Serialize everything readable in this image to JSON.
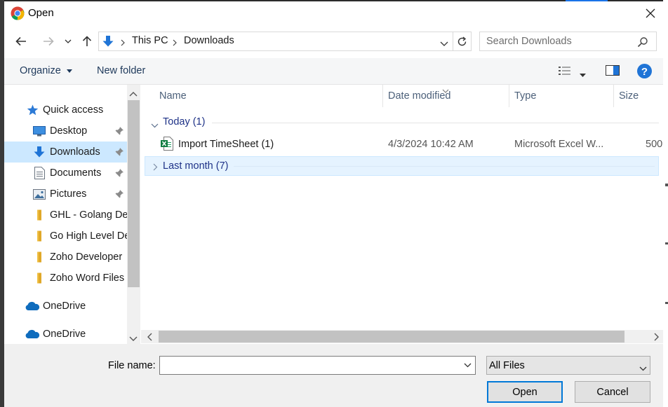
{
  "window": {
    "title": "Open",
    "app_icon": "chrome-icon",
    "accent_color": "#0078d7"
  },
  "address": {
    "crumbs": [
      "This PC",
      "Downloads"
    ],
    "search_placeholder": "Search Downloads"
  },
  "toolbar": {
    "organize_label": "Organize",
    "new_folder_label": "New folder"
  },
  "sidebar": {
    "items": [
      {
        "label": "Quick access",
        "icon": "star-icon"
      },
      {
        "label": "Desktop",
        "icon": "desktop-icon",
        "pinned": true
      },
      {
        "label": "Downloads",
        "icon": "download-icon",
        "pinned": true,
        "selected": true
      },
      {
        "label": "Documents",
        "icon": "document-icon",
        "pinned": true
      },
      {
        "label": "Pictures",
        "icon": "pictures-icon",
        "pinned": true
      },
      {
        "label": "GHL - Golang Dev",
        "icon": "folder-icon"
      },
      {
        "label": "Go High Level Dev",
        "icon": "folder-icon"
      },
      {
        "label": "Zoho Developer",
        "icon": "folder-icon"
      },
      {
        "label": "Zoho Word Files",
        "icon": "folder-icon"
      },
      {
        "label": "OneDrive",
        "icon": "cloud-icon"
      },
      {
        "label": "OneDrive",
        "icon": "cloud-icon"
      }
    ]
  },
  "file_list": {
    "columns": [
      "Name",
      "Date modified",
      "Type",
      "Size"
    ],
    "groups": [
      {
        "label": "Today (1)",
        "expanded": true,
        "files": [
          {
            "name": "Import TimeSheet  (1)",
            "date": "4/3/2024 10:42 AM",
            "type": "Microsoft Excel W...",
            "size": "500",
            "icon": "excel-icon"
          }
        ]
      },
      {
        "label": "Last month (7)",
        "expanded": false,
        "files": []
      }
    ]
  },
  "bottom": {
    "file_name_label": "File name:",
    "file_name_value": "",
    "filter_value": "All Files",
    "open_label": "Open",
    "cancel_label": "Cancel"
  }
}
